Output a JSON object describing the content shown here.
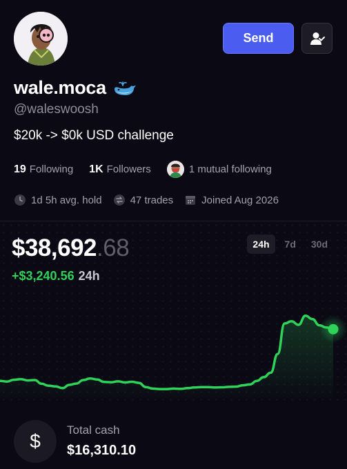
{
  "profile": {
    "display_name": "wale.moca",
    "handle": "@waleswoosh",
    "bio": "$20k -> $0k USD challenge",
    "badge_icon": "whale-icon"
  },
  "actions": {
    "send_label": "Send",
    "follow_icon": "user-check-icon"
  },
  "stats": {
    "following_count": "19",
    "following_label": "Following",
    "followers_count": "1K",
    "followers_label": "Followers",
    "mutual_label": "1 mutual following"
  },
  "meta": {
    "avg_hold": "1d 5h avg. hold",
    "trades": "47 trades",
    "joined": "Joined Aug 2026"
  },
  "portfolio": {
    "balance_main": "$38,692",
    "balance_cents": ".68",
    "change_value": "+$3,240.56",
    "change_period": "24h",
    "ranges": [
      "24h",
      "7d",
      "30d"
    ],
    "active_range": "24h",
    "line_color": "#2fd35a"
  },
  "chart_data": {
    "type": "line",
    "title": "",
    "xlabel": "",
    "ylabel": "",
    "x": [
      0,
      1,
      2,
      3,
      4,
      5,
      6,
      7,
      8,
      9,
      10,
      11,
      12,
      13,
      14,
      15,
      16,
      17,
      18,
      19,
      20,
      21,
      22,
      23,
      24,
      25,
      26,
      27,
      28,
      29,
      30,
      31,
      32,
      33,
      34,
      35,
      36,
      37,
      38,
      39,
      40,
      41,
      42,
      43,
      44,
      45,
      46,
      47,
      48
    ],
    "values": [
      35380,
      35350,
      35430,
      35460,
      35400,
      35420,
      35250,
      35160,
      35130,
      35050,
      35200,
      35260,
      35420,
      35490,
      35440,
      35330,
      35320,
      35360,
      35310,
      35340,
      35290,
      35100,
      35030,
      35010,
      35010,
      35030,
      35020,
      35050,
      35080,
      35100,
      35100,
      35080,
      35090,
      35110,
      35120,
      35180,
      35220,
      35380,
      35550,
      35750,
      36600,
      37980,
      38080,
      37920,
      38330,
      38180,
      37900,
      37800,
      37720
    ],
    "ylim": [
      34700,
      38700
    ]
  },
  "cash": {
    "label": "Total cash",
    "value": "$16,310.10",
    "icon": "dollar-icon"
  }
}
